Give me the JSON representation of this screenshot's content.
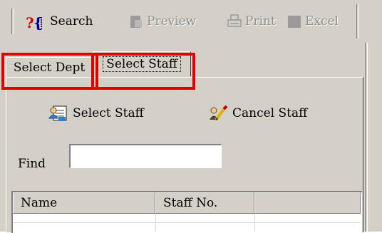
{
  "toolbar": {
    "search_label": "Search",
    "preview_label": "Preview",
    "print_label": "Print",
    "excel_label": "Excel"
  },
  "tabs": [
    {
      "label": "Select Dept",
      "selected": false
    },
    {
      "label": "Select Staff",
      "selected": true
    }
  ],
  "actions": {
    "select_staff_label": "Select Staff",
    "cancel_staff_label": "Cancel Staff"
  },
  "find": {
    "label": "Find",
    "value": ""
  },
  "list": {
    "columns": [
      "Name",
      "Staff No.",
      ""
    ]
  },
  "colors": {
    "highlight_box": "#e00000",
    "face": "#d4d0c8",
    "search_icon_accent": "#cc0000"
  },
  "icons": {
    "search": "question-brace-icon",
    "preview": "preview-icon",
    "print": "printer-icon",
    "excel": "excel-icon",
    "select_staff": "person-card-icon",
    "cancel_staff": "cancel-user-pen-icon"
  }
}
